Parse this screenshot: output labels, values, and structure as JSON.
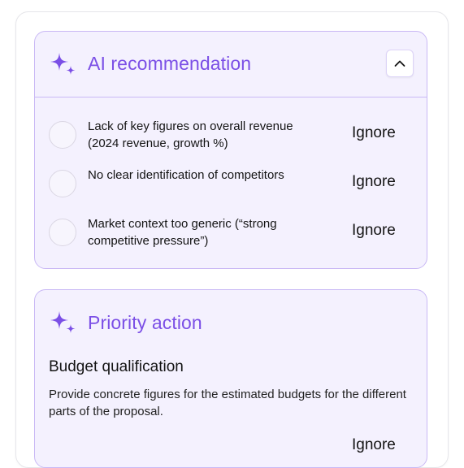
{
  "reco_card": {
    "title": "AI recommendation",
    "icon": "sparkle-icon",
    "collapse_icon": "chevron-up-icon",
    "items": [
      {
        "text": "Lack of key figures on overall revenue (2024 revenue, growth %)",
        "action": "Ignore"
      },
      {
        "text": "No clear identification of competitors",
        "action": "Ignore"
      },
      {
        "text": "Market context too generic (“strong competitive pressure”)",
        "action": "Ignore"
      }
    ]
  },
  "priority_card": {
    "title": "Priority action",
    "icon": "sparkle-icon",
    "subtitle": "Budget qualification",
    "description": "Provide concrete figures for the estimated budgets for the different parts of the proposal.",
    "action": "Ignore"
  },
  "colors": {
    "accent": "#7b4fe6",
    "card_bg": "#f4f1fe",
    "card_border": "#c9b8f5"
  }
}
